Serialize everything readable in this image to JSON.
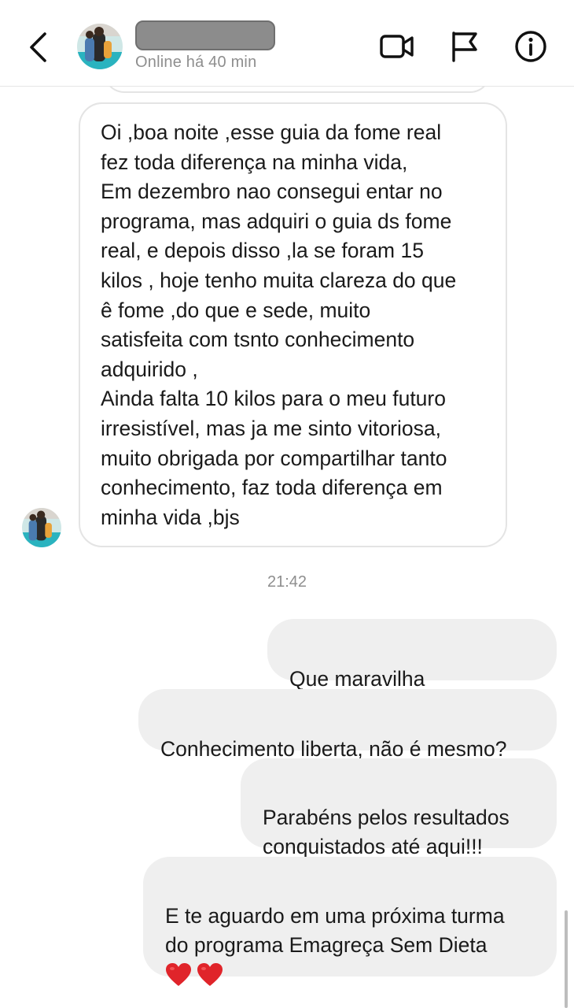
{
  "header": {
    "contact_name": "",
    "status": "Online há 40 min",
    "icons": {
      "back": "chevron-left-icon",
      "video": "video-call-icon",
      "flag": "flag-icon",
      "info": "info-icon"
    }
  },
  "messages": {
    "received": {
      "text": "Oi ,boa noite ,esse guia da fome real\nfez toda diferença na minha vida,\nEm dezembro nao consegui entar no\nprograma, mas adquiri o guia ds fome\nreal,  e depois disso ,la se foram 15\nkilos , hoje tenho muita clareza do que\nê fome ,do que e sede,   muito\nsatisfeita com tsnto conhecimento\nadquirido ,\nAinda falta 10 kilos para o meu futuro\nirresistível,  mas ja me sinto vitoriosa,\nmuito obrigada por compartilhar tanto\nconhecimento,  faz toda diferença em\nminha vida ,bjs"
    },
    "timestamp": "21:42",
    "sent": [
      {
        "text": "Que maravilha",
        "emoji": "🥰🥰🥰"
      },
      {
        "text": "Conhecimento liberta, não é mesmo?"
      },
      {
        "text": "Parabéns pelos resultados\nconquistados até aqui!!!"
      },
      {
        "text": "E te aguardo em uma próxima turma\ndo programa Emagreça Sem Dieta",
        "emoji": "❤️❤️"
      }
    ]
  },
  "colors": {
    "sent_bubble": "#efefef",
    "received_border": "#e4e4e4",
    "muted_text": "#8e8e8e"
  }
}
